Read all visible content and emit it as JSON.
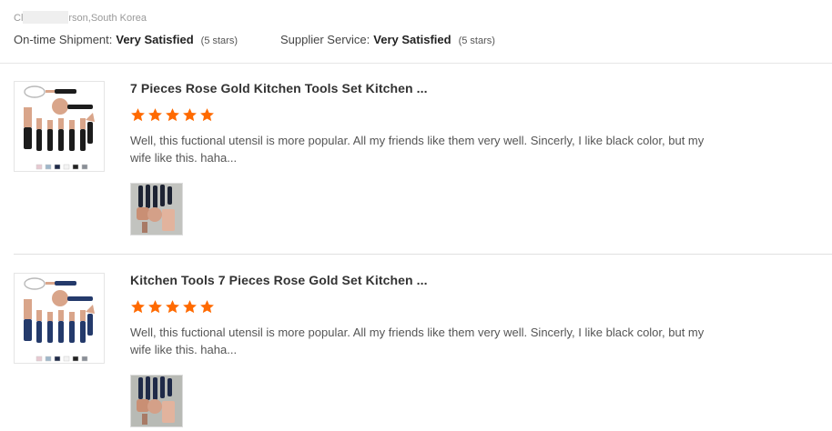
{
  "reviewer": {
    "name_prefix": "Cl",
    "name_suffix": "rson,South Korea"
  },
  "ratings": {
    "shipment_label": "On-time Shipment:",
    "shipment_value": "Very Satisfied",
    "shipment_stars": "(5 stars)",
    "service_label": "Supplier Service:",
    "service_value": "Very Satisfied",
    "service_stars": "(5 stars)"
  },
  "reviews": [
    {
      "title": "7 Pieces Rose Gold Kitchen Tools Set Kitchen ...",
      "stars": 5,
      "text": "Well, this fuctional utensil is more popular. All my friends like them very well. Sincerly, I like black color, but my wife like this. haha...",
      "handle_color": "#1c1c1c"
    },
    {
      "title": "Kitchen Tools 7 Pieces Rose Gold Set Kitchen ...",
      "stars": 5,
      "text": "Well, this fuctional utensil is more popular. All my friends like them very well. Sincerly, I like black color, but my wife like this. haha...",
      "handle_color": "#243a6b"
    }
  ],
  "colors": {
    "star": "#ff6a00",
    "rose_gold": "#d9a58a"
  }
}
